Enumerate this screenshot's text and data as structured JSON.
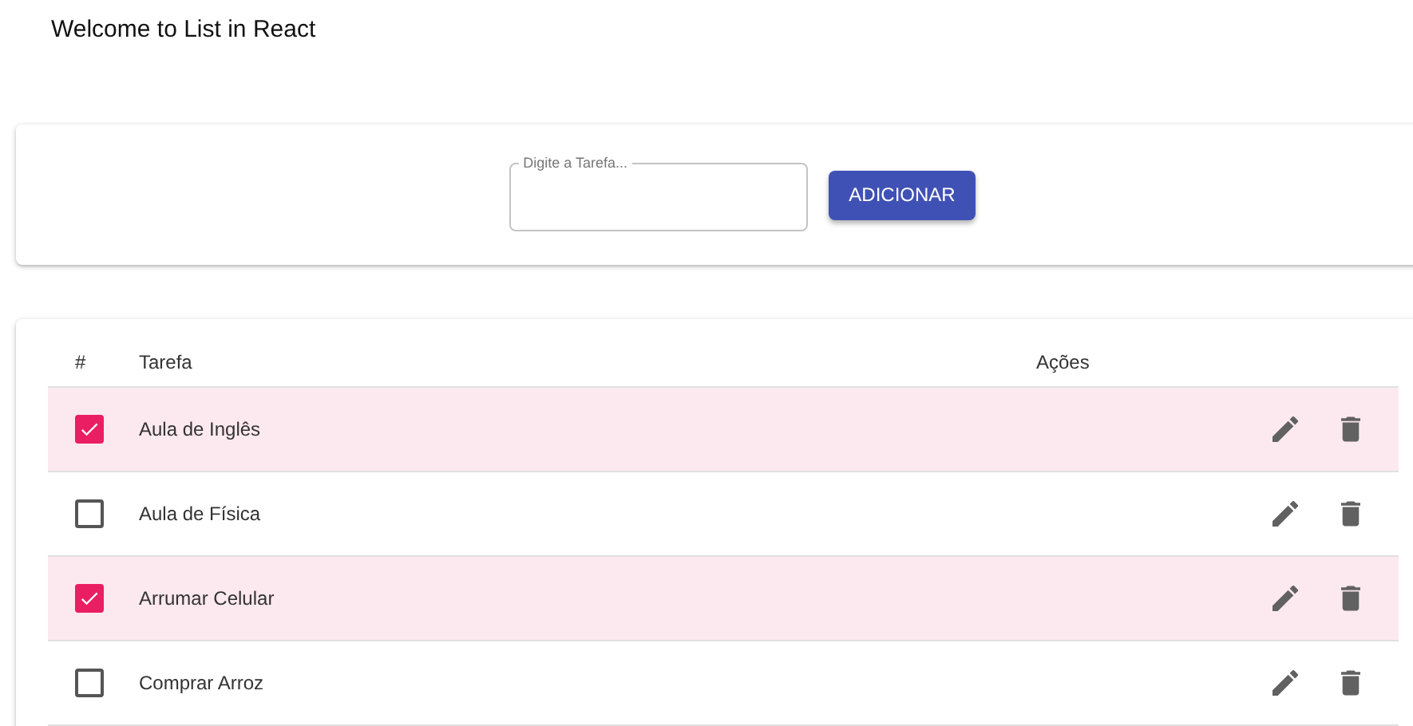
{
  "title": "Welcome to List in React",
  "form": {
    "placeholder": "Digite a Tarefa...",
    "button": "ADICIONAR"
  },
  "table": {
    "columns": [
      "#",
      "Tarefa",
      "Ações"
    ],
    "rows": [
      {
        "task": "Aula de Inglês",
        "checked": true
      },
      {
        "task": "Aula de Física",
        "checked": false
      },
      {
        "task": "Arrumar Celular",
        "checked": true
      },
      {
        "task": "Comprar Arroz",
        "checked": false
      }
    ]
  }
}
